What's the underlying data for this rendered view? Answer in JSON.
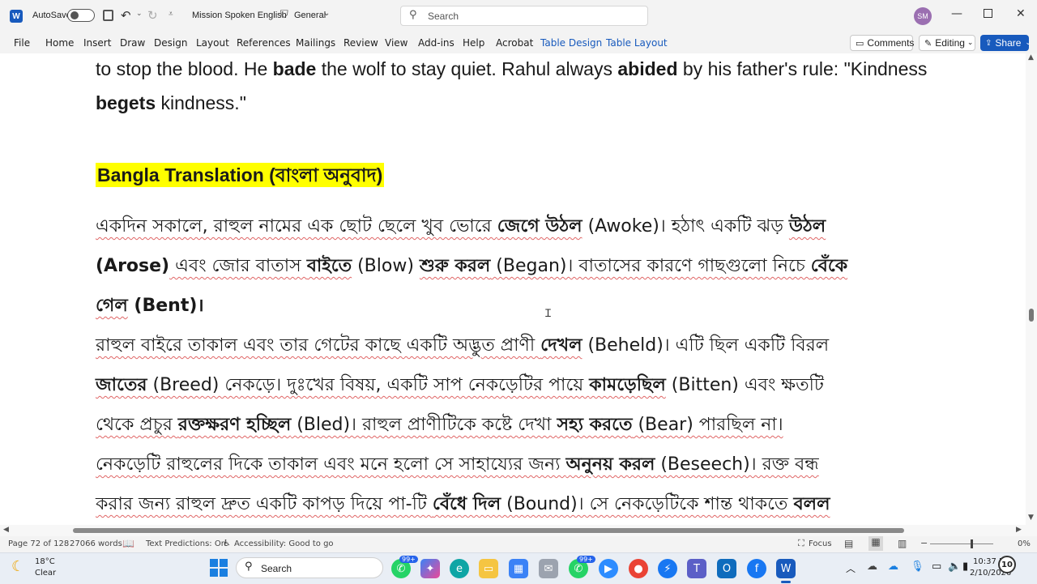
{
  "titlebar": {
    "autosave_label": "AutoSave",
    "autosave_state": "Off",
    "document_name": "Mission Spoken English",
    "sensitivity": "General",
    "search_placeholder": "Search",
    "avatar_initials": "SM"
  },
  "ribbon": {
    "tabs": [
      "File",
      "Home",
      "Insert",
      "Draw",
      "Design",
      "Layout",
      "References",
      "Mailings",
      "Review",
      "View",
      "Add-ins",
      "Help",
      "Acrobat",
      "Table Design",
      "Table Layout"
    ],
    "comments_label": "Comments",
    "editing_label": "Editing",
    "share_label": "Share"
  },
  "document": {
    "line1_a": "to stop the blood. He ",
    "line1_b": "bade",
    "line1_c": " the wolf to stay quiet. Rahul always ",
    "line1_d": "abided",
    "line1_e": " by his father's rule: \"Kindness",
    "line2_a": "begets",
    "line2_b": " kindness.\"",
    "heading": "Bangla Translation (বাংলা অনুবাদ)",
    "bn1_a": "একদিন সকালে, রাহুল নামের এক ছোট ছেলে খুব ভোরে ",
    "bn1_b": "জেগে উঠল",
    "bn1_c": " (Awoke)। হঠাৎ একটি ঝড় ",
    "bn1_d": "উঠল",
    "bn2_a": "(Arose)",
    "bn2_b": " এবং জোর বাতাস ",
    "bn2_c": "বাইতে",
    "bn2_d": " (Blow) ",
    "bn2_e": "শুরু করল",
    "bn2_f": " (Began)। বাতাসের কারণে গাছগুলো নিচে ",
    "bn2_g": "বেঁকে",
    "bn3_a": "গেল",
    "bn3_b": " (Bent)।",
    "bn4_a": "রাহুল বাইরে তাকাল এবং তার গেটের কাছে একটি অদ্ভুত প্রাণী ",
    "bn4_b": "দেখল",
    "bn4_c": " (Beheld)। এটি ছিল একটি বিরল",
    "bn5_a": "জাতের",
    "bn5_b": " (Breed) নেকড়ে। দুঃখের বিষয়, একটি সাপ নেকড়েটির পায়ে ",
    "bn5_c": "কামড়েছিল",
    "bn5_d": " (Bitten) এবং ক্ষতটি",
    "bn6_a": "থেকে প্রচুর ",
    "bn6_b": "রক্তক্ষরণ হচ্ছিল",
    "bn6_c": " (Bled)। রাহুল প্রাণীটিকে কষ্টে দেখা ",
    "bn6_d": "সহ্য করতে",
    "bn6_e": " (Bear) পারছিল না।",
    "bn7_a": "নেকড়েটি রাহুলের দিকে তাকাল এবং মনে হলো সে সাহায্যের জন্য ",
    "bn7_b": "অনুনয় করল",
    "bn7_c": " (Beseech)। রক্ত বন্ধ",
    "bn8_a": "করার জন্য রাহুল দ্রুত একটি কাপড় দিয়ে পা-টি ",
    "bn8_b": "বেঁধে দিল",
    "bn8_c": " (Bound)। সে নেকড়েটিকে শান্ত থাকতে ",
    "bn8_d": "বলল"
  },
  "status": {
    "page": "Page 72 of 128",
    "words": "27066 words",
    "text_predictions": "Text Predictions: On",
    "accessibility": "Accessibility: Good to go",
    "focus": "Focus",
    "zoom": "0%"
  },
  "taskbar": {
    "weather_temp": "18°C",
    "weather_desc": "Clear",
    "search_label": "Search",
    "badge1": "99+",
    "badge2": "99+",
    "time": "10:37 PM",
    "date": "2/10/2026",
    "notif_count": "10"
  }
}
